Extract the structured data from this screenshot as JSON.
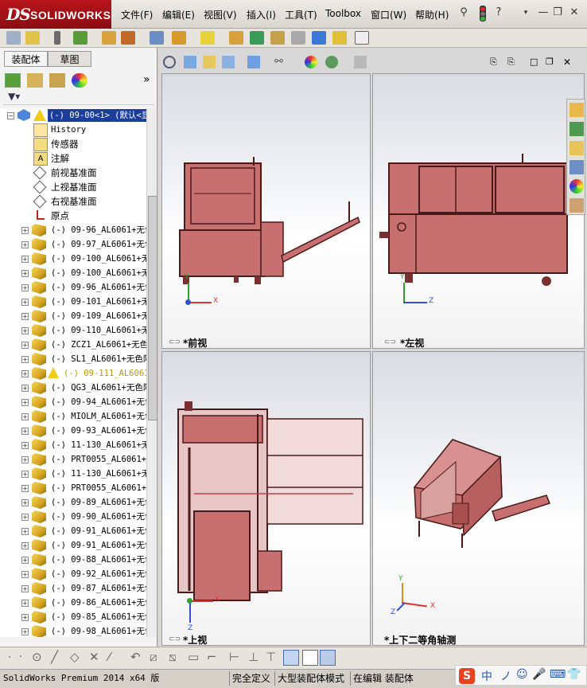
{
  "app": {
    "brand_ds": "DS",
    "brand_name": "SOLIDWORKS"
  },
  "menu": {
    "items": [
      "文件(F)",
      "编辑(E)",
      "视图(V)",
      "插入(I)",
      "工具(T)",
      "Toolbox",
      "窗口(W)",
      "帮助(H)"
    ]
  },
  "panel": {
    "tab_assembly": "装配体",
    "tab_sketch": "草图",
    "expand": "»",
    "filter_icon": "filter-icon"
  },
  "tree": {
    "root": "(-) 09-00<1> (默认<显",
    "history": "History",
    "sensors": "传感器",
    "annotations": "注解",
    "front_plane": "前视基准面",
    "top_plane": "上视基准面",
    "right_plane": "右视基准面",
    "origin": "原点",
    "parts": [
      "(-) 09-96_AL6061+无色",
      "(-) 09-97_AL6061+无色",
      "(-) 09-100_AL6061+无",
      "(-) 09-100_AL6061+无",
      "(-) 09-96_AL6061+无色",
      "(-) 09-101_AL6061+无",
      "(-) 09-109_AL6061+无",
      "(-) 09-110_AL6061+无",
      "(-) ZCZ1_AL6061+无色",
      "(-) SL1_AL6061+无色阳",
      "(-) 09-111_AL6061",
      "(-) QG3_AL6061+无色阳",
      "(-) 09-94_AL6061+无色",
      "(-) MIOLM_AL6061+无色",
      "(-) 09-93_AL6061+无色",
      "(-) 11-130_AL6061+无",
      "(-) PRT0055_AL6061+无",
      "(-) 11-130_AL6061+无",
      "(-) PRT0055_AL6061+无",
      "(-) 09-89_AL6061+无色",
      "(-) 09-90_AL6061+无色",
      "(-) 09-91_AL6061+无色",
      "(-) 09-91_AL6061+无色",
      "(-) 09-88_AL6061+无色",
      "(-) 09-92_AL6061+无色",
      "(-) 09-87_AL6061+无色",
      "(-) 09-86_AL6061+无色",
      "(-) 09-85_AL6061+无色",
      "(-) 09-98_AL6061+无色"
    ],
    "warning_index": 10
  },
  "viewports": {
    "front": "*前视",
    "left": "*左视",
    "top": "*上视",
    "iso": "*上下二等角轴测"
  },
  "axes": {
    "x": "X",
    "y": "Y",
    "z": "Z"
  },
  "status": {
    "version": "SolidWorks Premium 2014 x64 版",
    "state": "完全定义",
    "mode": "大型装配体模式",
    "editing": "在编辑 装配体"
  },
  "ime": {
    "label": "中"
  },
  "colors": {
    "brand_red": "#a5121a",
    "model": "#c87070",
    "model_dark": "#7a3030",
    "axis_x": "#e03030",
    "axis_y": "#30a030",
    "axis_z": "#3050d0"
  }
}
